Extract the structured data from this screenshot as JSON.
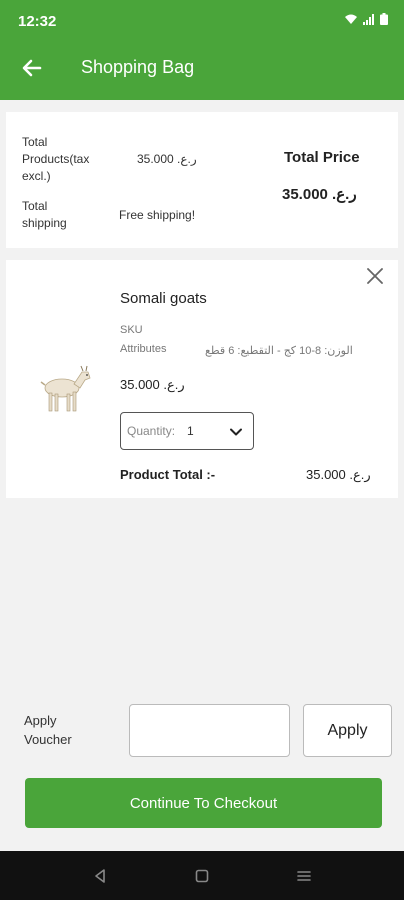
{
  "status_bar": {
    "time": "12:32"
  },
  "header": {
    "title": "Shopping Bag"
  },
  "summary": {
    "total_products_label": "Total Products(tax excl.)",
    "total_products_value": "ر.ع. 35.000",
    "total_shipping_label": "Total shipping",
    "total_shipping_value": "Free shipping!",
    "total_price_title": "Total Price",
    "total_price_value": "ر.ع. 35.000"
  },
  "product": {
    "name": "Somali goats",
    "sku_label": "SKU",
    "attributes_label": "Attributes",
    "attributes_value": "الوزن: 8-10 كج - التقطيع: 6 قطع",
    "price": "ر.ع. 35.000",
    "quantity_label": "Quantity:",
    "quantity_value": "1",
    "product_total_label": "Product Total :-",
    "product_total_value": "ر.ع. 35.000"
  },
  "voucher": {
    "label": "Apply Voucher",
    "input_value": "",
    "apply_label": "Apply"
  },
  "checkout": {
    "label": "Continue To Checkout"
  },
  "colors": {
    "primary_green": "#4aa53a"
  },
  "icons": {
    "back": "arrow-left-icon",
    "remove": "close-icon",
    "dropdown": "chevron-down-icon",
    "product": "goat-image"
  }
}
